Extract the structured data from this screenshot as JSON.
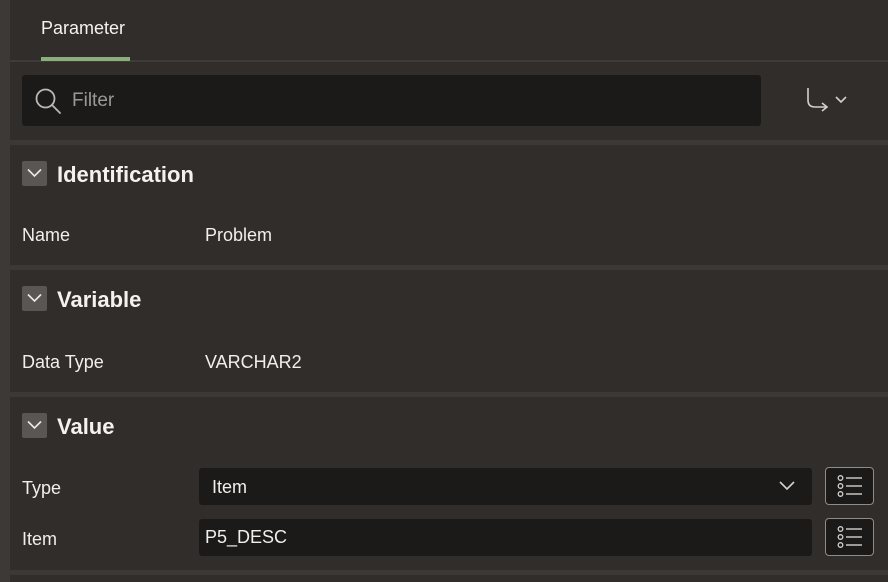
{
  "tabs": [
    {
      "label": "Parameter",
      "active": true
    }
  ],
  "filter": {
    "placeholder": "Filter",
    "value": ""
  },
  "sections": {
    "identification": {
      "title": "Identification",
      "name_label": "Name",
      "name_value": "Problem"
    },
    "variable": {
      "title": "Variable",
      "data_type_label": "Data Type",
      "data_type_value": "VARCHAR2"
    },
    "value": {
      "title": "Value",
      "type_label": "Type",
      "type_value": "Item",
      "item_label": "Item",
      "item_value": "P5_DESC"
    }
  },
  "icons": {
    "filter": "search-icon",
    "goto": "go-to-group-icon",
    "collapse": "chevron-down-icon",
    "list": "list-of-values-icon"
  },
  "colors": {
    "background": "#312d2a",
    "field_background": "#1c1a19",
    "tab_accent": "#8aaf7a",
    "text": "#f1efed",
    "placeholder": "#9c9894"
  }
}
